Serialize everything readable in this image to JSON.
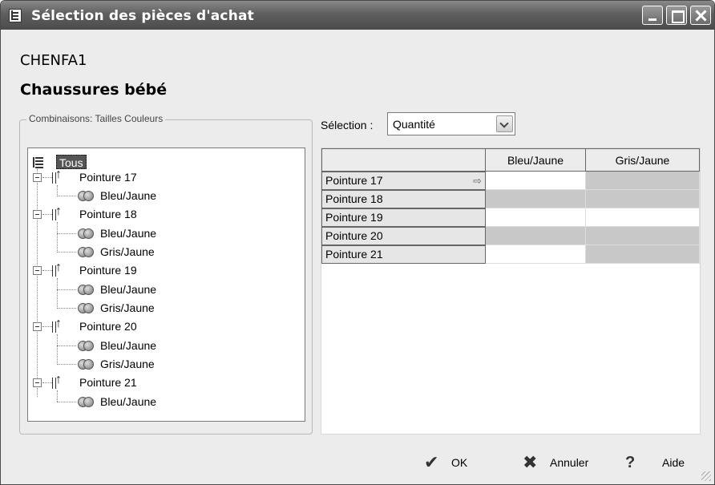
{
  "window": {
    "title": "Sélection des pièces d'achat",
    "icon": "app-document-icon"
  },
  "header": {
    "code": "CHENFA1",
    "designation": "Chaussures bébé"
  },
  "combinations": {
    "group_label": "Combinaisons: Tailles Couleurs",
    "root": "Tous",
    "sizes": [
      {
        "label": "Pointure 17",
        "colors": [
          "Bleu/Jaune"
        ]
      },
      {
        "label": "Pointure 18",
        "colors": [
          "Bleu/Jaune",
          "Gris/Jaune"
        ]
      },
      {
        "label": "Pointure 19",
        "colors": [
          "Bleu/Jaune",
          "Gris/Jaune"
        ]
      },
      {
        "label": "Pointure 20",
        "colors": [
          "Bleu/Jaune",
          "Gris/Jaune"
        ]
      },
      {
        "label": "Pointure 21",
        "colors": [
          "Bleu/Jaune"
        ]
      }
    ]
  },
  "selection": {
    "label": "Sélection :",
    "value": "Quantité"
  },
  "grid": {
    "columns": [
      "Bleu/Jaune",
      "Gris/Jaune"
    ],
    "rows": [
      "Pointure 17",
      "Pointure 18",
      "Pointure 19",
      "Pointure 20",
      "Pointure 21"
    ],
    "current_row_indicator": "arrow-right-icon"
  },
  "buttons": {
    "ok": "OK",
    "cancel": "Annuler",
    "help": "Aide"
  }
}
